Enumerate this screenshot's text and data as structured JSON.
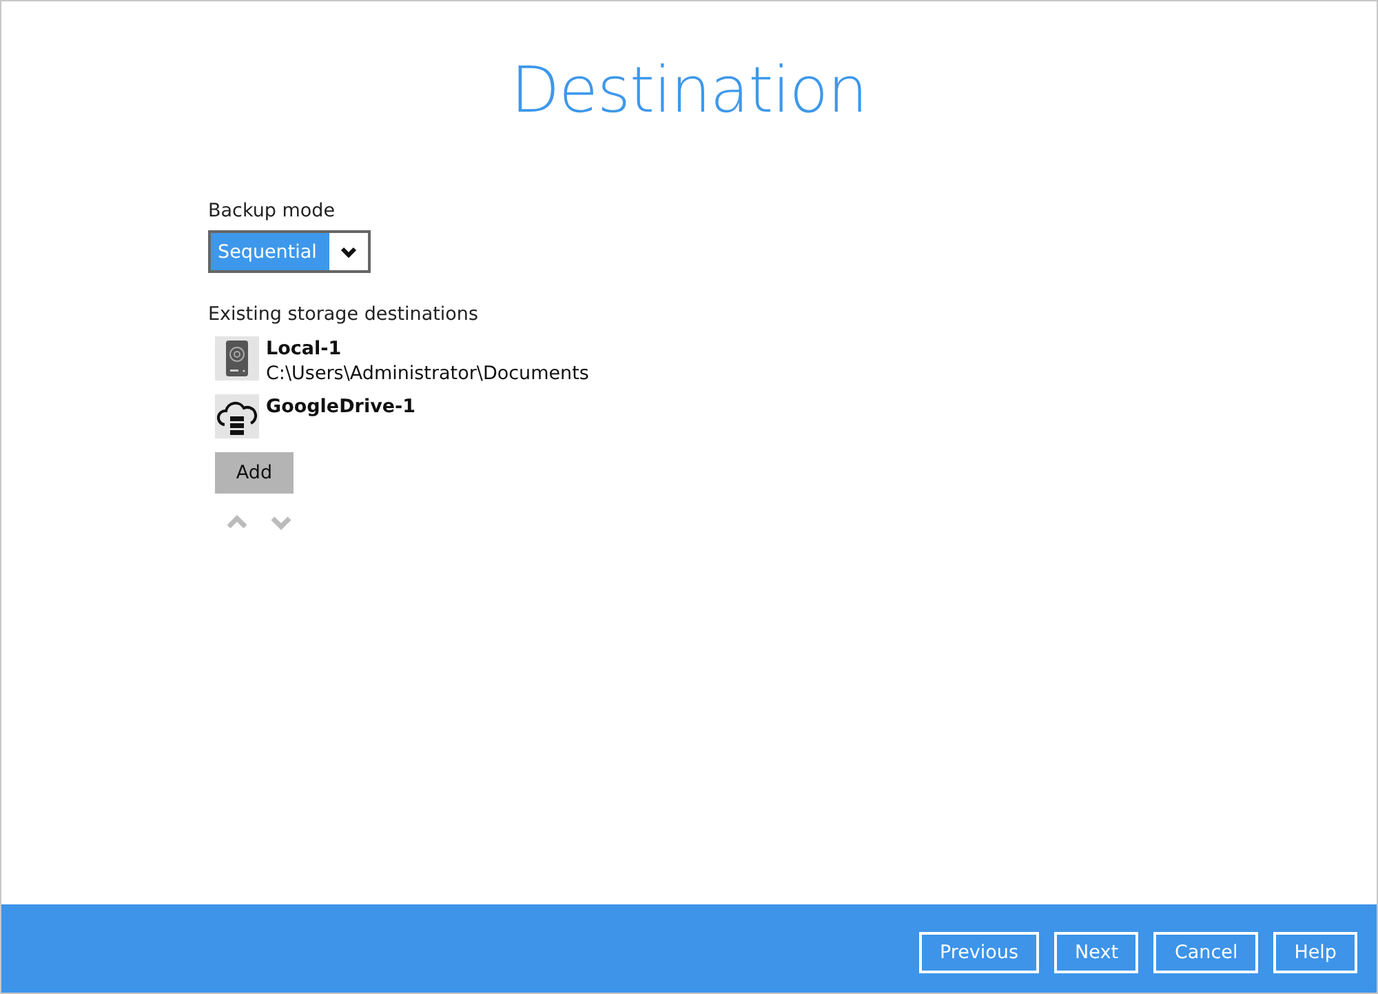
{
  "title": "Destination",
  "backup_mode": {
    "label": "Backup mode",
    "value": "Sequential"
  },
  "destinations": {
    "label": "Existing storage destinations",
    "items": [
      {
        "kind": "local",
        "name": "Local-1",
        "path": "C:\\Users\\Administrator\\Documents"
      },
      {
        "kind": "cloud",
        "name": "GoogleDrive-1"
      }
    ],
    "add_button": "Add",
    "reorder": [
      {
        "kind": "up",
        "disabled": true
      },
      {
        "kind": "down",
        "disabled": true
      }
    ]
  },
  "footer_buttons": [
    "Previous",
    "Next",
    "Cancel",
    "Help"
  ]
}
